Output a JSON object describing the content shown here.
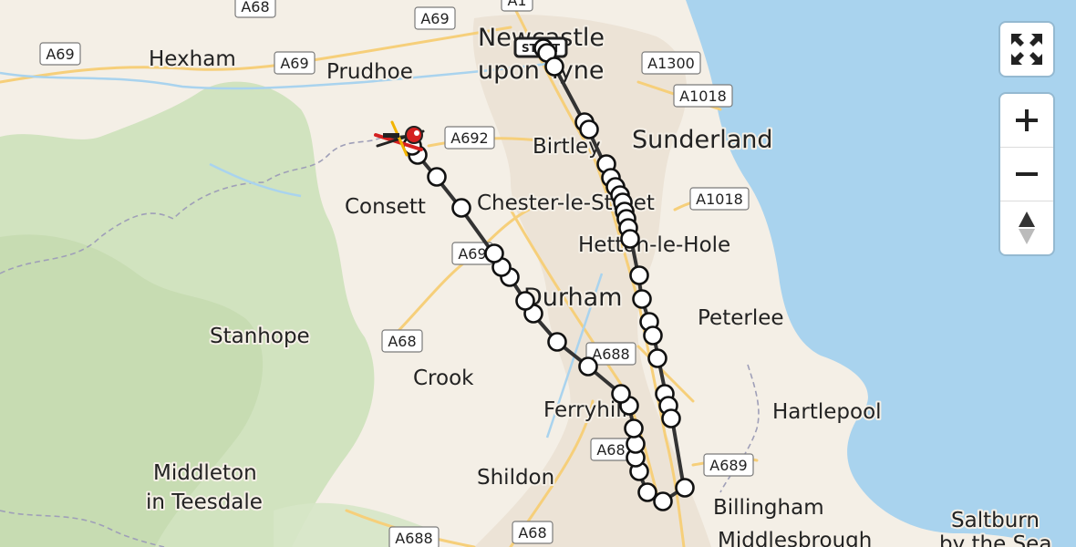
{
  "map": {
    "colors": {
      "land": "#f4efe6",
      "sea": "#a9d3ee",
      "forest": "#cfe1bd",
      "urban": "#ece3d6",
      "route": "#333333",
      "stop": "#ffffff"
    },
    "places": [
      {
        "id": "hexham",
        "name": "Hexham"
      },
      {
        "id": "prudhoe",
        "name": "Prudhoe"
      },
      {
        "id": "newcastle-1",
        "name": "Newcastle"
      },
      {
        "id": "newcastle-2",
        "name": "upon Tyne"
      },
      {
        "id": "birtley",
        "name": "Birtley"
      },
      {
        "id": "sunderland",
        "name": "Sunderland"
      },
      {
        "id": "consett",
        "name": "Consett"
      },
      {
        "id": "chester",
        "name": "Chester-le-Street"
      },
      {
        "id": "hetton",
        "name": "Hetton-le-Hole"
      },
      {
        "id": "durham",
        "name": "Durham"
      },
      {
        "id": "peterlee",
        "name": "Peterlee"
      },
      {
        "id": "stanhope",
        "name": "Stanhope"
      },
      {
        "id": "crook",
        "name": "Crook"
      },
      {
        "id": "ferryhill",
        "name": "Ferryhill"
      },
      {
        "id": "hartlepool",
        "name": "Hartlepool"
      },
      {
        "id": "shildon",
        "name": "Shildon"
      },
      {
        "id": "billingham",
        "name": "Billingham"
      },
      {
        "id": "middleton-1",
        "name": "Middleton"
      },
      {
        "id": "middleton-2",
        "name": "in Teesdale"
      },
      {
        "id": "middlesbrough",
        "name": "Middlesbrough"
      },
      {
        "id": "saltburn-1",
        "name": "Saltburn"
      },
      {
        "id": "saltburn-2",
        "name": "by the Sea"
      }
    ],
    "roads": [
      {
        "id": "a68-top",
        "ref": "A68"
      },
      {
        "id": "a69-nw",
        "ref": "A69"
      },
      {
        "id": "a69-n",
        "ref": "A69"
      },
      {
        "id": "a69-mid",
        "ref": "A69"
      },
      {
        "id": "a1",
        "ref": "A1"
      },
      {
        "id": "a1300",
        "ref": "A1300"
      },
      {
        "id": "a1018-n",
        "ref": "A1018"
      },
      {
        "id": "a692",
        "ref": "A692"
      },
      {
        "id": "a1018-s",
        "ref": "A1018"
      },
      {
        "id": "a691",
        "ref": "A69"
      },
      {
        "id": "a68-mid",
        "ref": "A68"
      },
      {
        "id": "a688-mid",
        "ref": "A688"
      },
      {
        "id": "a689",
        "ref": "A689"
      },
      {
        "id": "a68-ferry",
        "ref": "A68"
      },
      {
        "id": "a688-bot",
        "ref": "A688"
      },
      {
        "id": "a68-bot",
        "ref": "A68"
      }
    ],
    "markers": {
      "start_label": "START",
      "destination_icon": "helicopter-icon"
    }
  },
  "controls": {
    "fullscreen": {
      "icon": "fullscreen-icon"
    },
    "zoom_in": {
      "icon": "plus-icon"
    },
    "zoom_out": {
      "icon": "minus-icon"
    },
    "compass": {
      "icon": "compass-icon"
    }
  }
}
